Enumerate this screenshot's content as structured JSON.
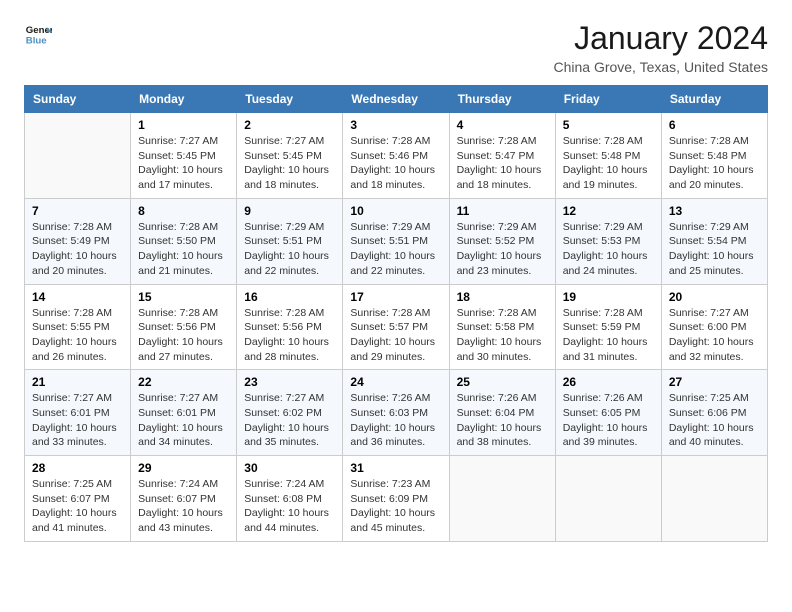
{
  "logo": {
    "line1": "General",
    "line2": "Blue"
  },
  "title": "January 2024",
  "location": "China Grove, Texas, United States",
  "weekdays": [
    "Sunday",
    "Monday",
    "Tuesday",
    "Wednesday",
    "Thursday",
    "Friday",
    "Saturday"
  ],
  "weeks": [
    [
      {
        "day": "",
        "sunrise": "",
        "sunset": "",
        "daylight": ""
      },
      {
        "day": "1",
        "sunrise": "Sunrise: 7:27 AM",
        "sunset": "Sunset: 5:45 PM",
        "daylight": "Daylight: 10 hours and 17 minutes."
      },
      {
        "day": "2",
        "sunrise": "Sunrise: 7:27 AM",
        "sunset": "Sunset: 5:45 PM",
        "daylight": "Daylight: 10 hours and 18 minutes."
      },
      {
        "day": "3",
        "sunrise": "Sunrise: 7:28 AM",
        "sunset": "Sunset: 5:46 PM",
        "daylight": "Daylight: 10 hours and 18 minutes."
      },
      {
        "day": "4",
        "sunrise": "Sunrise: 7:28 AM",
        "sunset": "Sunset: 5:47 PM",
        "daylight": "Daylight: 10 hours and 18 minutes."
      },
      {
        "day": "5",
        "sunrise": "Sunrise: 7:28 AM",
        "sunset": "Sunset: 5:48 PM",
        "daylight": "Daylight: 10 hours and 19 minutes."
      },
      {
        "day": "6",
        "sunrise": "Sunrise: 7:28 AM",
        "sunset": "Sunset: 5:48 PM",
        "daylight": "Daylight: 10 hours and 20 minutes."
      }
    ],
    [
      {
        "day": "7",
        "sunrise": "Sunrise: 7:28 AM",
        "sunset": "Sunset: 5:49 PM",
        "daylight": "Daylight: 10 hours and 20 minutes."
      },
      {
        "day": "8",
        "sunrise": "Sunrise: 7:28 AM",
        "sunset": "Sunset: 5:50 PM",
        "daylight": "Daylight: 10 hours and 21 minutes."
      },
      {
        "day": "9",
        "sunrise": "Sunrise: 7:29 AM",
        "sunset": "Sunset: 5:51 PM",
        "daylight": "Daylight: 10 hours and 22 minutes."
      },
      {
        "day": "10",
        "sunrise": "Sunrise: 7:29 AM",
        "sunset": "Sunset: 5:51 PM",
        "daylight": "Daylight: 10 hours and 22 minutes."
      },
      {
        "day": "11",
        "sunrise": "Sunrise: 7:29 AM",
        "sunset": "Sunset: 5:52 PM",
        "daylight": "Daylight: 10 hours and 23 minutes."
      },
      {
        "day": "12",
        "sunrise": "Sunrise: 7:29 AM",
        "sunset": "Sunset: 5:53 PM",
        "daylight": "Daylight: 10 hours and 24 minutes."
      },
      {
        "day": "13",
        "sunrise": "Sunrise: 7:29 AM",
        "sunset": "Sunset: 5:54 PM",
        "daylight": "Daylight: 10 hours and 25 minutes."
      }
    ],
    [
      {
        "day": "14",
        "sunrise": "Sunrise: 7:28 AM",
        "sunset": "Sunset: 5:55 PM",
        "daylight": "Daylight: 10 hours and 26 minutes."
      },
      {
        "day": "15",
        "sunrise": "Sunrise: 7:28 AM",
        "sunset": "Sunset: 5:56 PM",
        "daylight": "Daylight: 10 hours and 27 minutes."
      },
      {
        "day": "16",
        "sunrise": "Sunrise: 7:28 AM",
        "sunset": "Sunset: 5:56 PM",
        "daylight": "Daylight: 10 hours and 28 minutes."
      },
      {
        "day": "17",
        "sunrise": "Sunrise: 7:28 AM",
        "sunset": "Sunset: 5:57 PM",
        "daylight": "Daylight: 10 hours and 29 minutes."
      },
      {
        "day": "18",
        "sunrise": "Sunrise: 7:28 AM",
        "sunset": "Sunset: 5:58 PM",
        "daylight": "Daylight: 10 hours and 30 minutes."
      },
      {
        "day": "19",
        "sunrise": "Sunrise: 7:28 AM",
        "sunset": "Sunset: 5:59 PM",
        "daylight": "Daylight: 10 hours and 31 minutes."
      },
      {
        "day": "20",
        "sunrise": "Sunrise: 7:27 AM",
        "sunset": "Sunset: 6:00 PM",
        "daylight": "Daylight: 10 hours and 32 minutes."
      }
    ],
    [
      {
        "day": "21",
        "sunrise": "Sunrise: 7:27 AM",
        "sunset": "Sunset: 6:01 PM",
        "daylight": "Daylight: 10 hours and 33 minutes."
      },
      {
        "day": "22",
        "sunrise": "Sunrise: 7:27 AM",
        "sunset": "Sunset: 6:01 PM",
        "daylight": "Daylight: 10 hours and 34 minutes."
      },
      {
        "day": "23",
        "sunrise": "Sunrise: 7:27 AM",
        "sunset": "Sunset: 6:02 PM",
        "daylight": "Daylight: 10 hours and 35 minutes."
      },
      {
        "day": "24",
        "sunrise": "Sunrise: 7:26 AM",
        "sunset": "Sunset: 6:03 PM",
        "daylight": "Daylight: 10 hours and 36 minutes."
      },
      {
        "day": "25",
        "sunrise": "Sunrise: 7:26 AM",
        "sunset": "Sunset: 6:04 PM",
        "daylight": "Daylight: 10 hours and 38 minutes."
      },
      {
        "day": "26",
        "sunrise": "Sunrise: 7:26 AM",
        "sunset": "Sunset: 6:05 PM",
        "daylight": "Daylight: 10 hours and 39 minutes."
      },
      {
        "day": "27",
        "sunrise": "Sunrise: 7:25 AM",
        "sunset": "Sunset: 6:06 PM",
        "daylight": "Daylight: 10 hours and 40 minutes."
      }
    ],
    [
      {
        "day": "28",
        "sunrise": "Sunrise: 7:25 AM",
        "sunset": "Sunset: 6:07 PM",
        "daylight": "Daylight: 10 hours and 41 minutes."
      },
      {
        "day": "29",
        "sunrise": "Sunrise: 7:24 AM",
        "sunset": "Sunset: 6:07 PM",
        "daylight": "Daylight: 10 hours and 43 minutes."
      },
      {
        "day": "30",
        "sunrise": "Sunrise: 7:24 AM",
        "sunset": "Sunset: 6:08 PM",
        "daylight": "Daylight: 10 hours and 44 minutes."
      },
      {
        "day": "31",
        "sunrise": "Sunrise: 7:23 AM",
        "sunset": "Sunset: 6:09 PM",
        "daylight": "Daylight: 10 hours and 45 minutes."
      },
      {
        "day": "",
        "sunrise": "",
        "sunset": "",
        "daylight": ""
      },
      {
        "day": "",
        "sunrise": "",
        "sunset": "",
        "daylight": ""
      },
      {
        "day": "",
        "sunrise": "",
        "sunset": "",
        "daylight": ""
      }
    ]
  ]
}
